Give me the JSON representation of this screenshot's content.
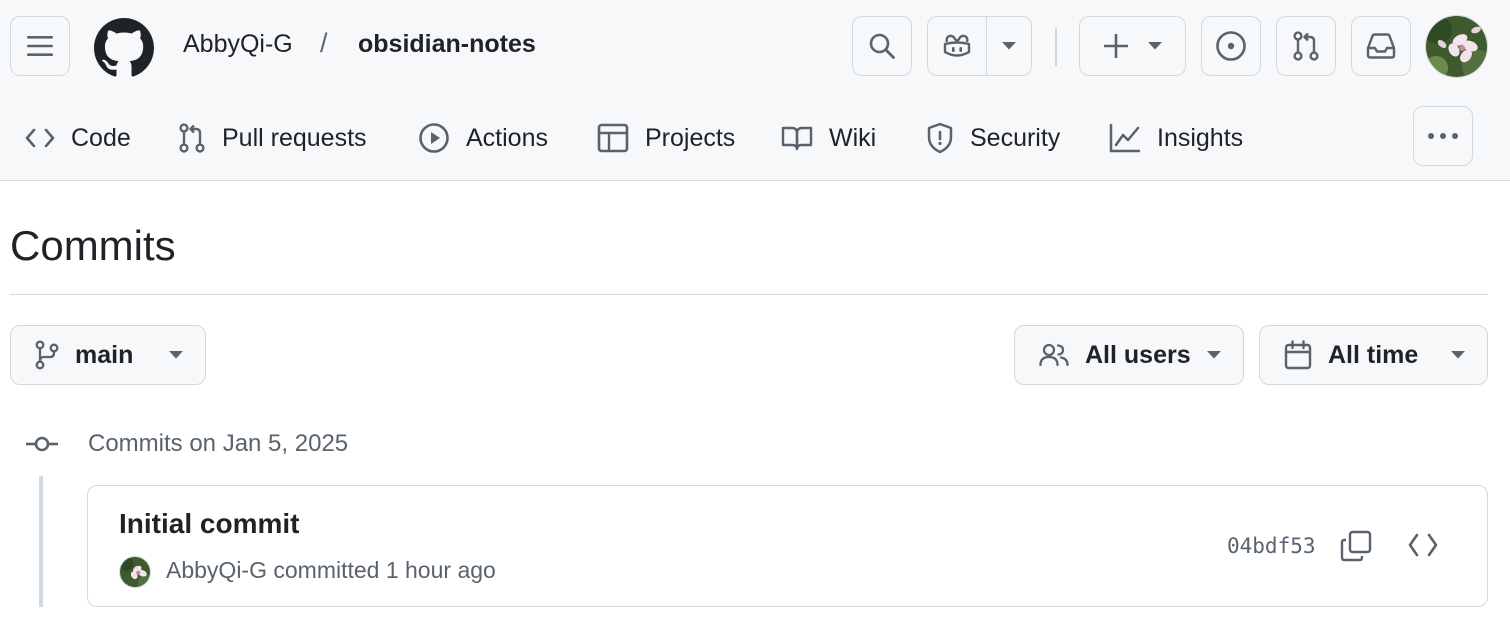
{
  "header": {
    "owner": "AbbyQi-G",
    "separator": "/",
    "repo": "obsidian-notes"
  },
  "repo_nav": {
    "items": [
      {
        "label": "Code",
        "icon": "code-icon"
      },
      {
        "label": "Pull requests",
        "icon": "git-pull-request-icon"
      },
      {
        "label": "Actions",
        "icon": "play-circle-icon"
      },
      {
        "label": "Projects",
        "icon": "table-icon"
      },
      {
        "label": "Wiki",
        "icon": "book-icon"
      },
      {
        "label": "Security",
        "icon": "shield-icon"
      },
      {
        "label": "Insights",
        "icon": "graph-icon"
      }
    ]
  },
  "page": {
    "title": "Commits"
  },
  "filters": {
    "branch": "main",
    "users": "All users",
    "time": "All time"
  },
  "commit_groups": [
    {
      "heading": "Commits on Jan 5, 2025",
      "commits": [
        {
          "message": "Initial commit",
          "meta": "AbbyQi-G committed 1 hour ago",
          "sha": "04bdf53"
        }
      ]
    }
  ],
  "colors": {
    "header_bg": "#f6f8fa",
    "border": "#d1d9e0",
    "text": "#1f2328",
    "muted": "#59636e"
  }
}
